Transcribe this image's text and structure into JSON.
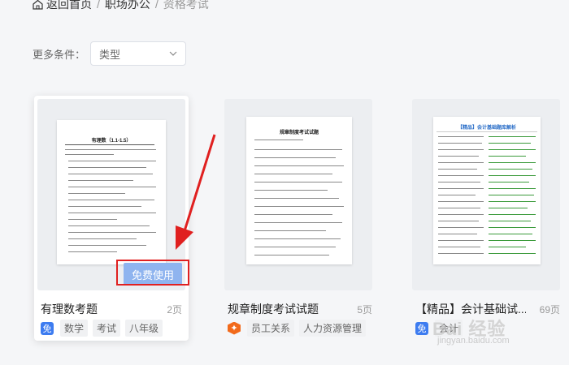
{
  "breadcrumb": {
    "home": "返回首页",
    "sep1": "/",
    "category": "职场办公",
    "sep2": "/",
    "current": "资格考试"
  },
  "filter": {
    "label": "更多条件：",
    "select_value": "类型"
  },
  "cards": [
    {
      "title": "有理数考题",
      "pages": "2页",
      "badge": "免",
      "tags": [
        "数学",
        "考试",
        "八年级"
      ],
      "doc_title": "有理数（1.1-1.5）",
      "free_button": "免费使用"
    },
    {
      "title": "规章制度考试试题",
      "pages": "5页",
      "tags": [
        "员工关系",
        "人力资源管理"
      ],
      "doc_title": "规章制度考试试题"
    },
    {
      "title": "【精品】会计基础试...",
      "pages": "69页",
      "badge": "免",
      "tags": [
        "会计"
      ],
      "doc_title": "【精品】会计基础题库解析"
    }
  ],
  "watermark": {
    "main": "Bai 经验",
    "sub": "jingyan.baidu.com"
  },
  "colors": {
    "accent": "#3d7cf0",
    "free_button": "#8fb4ef",
    "highlight": "#e02020",
    "hex_badge": "#f26a1b"
  }
}
